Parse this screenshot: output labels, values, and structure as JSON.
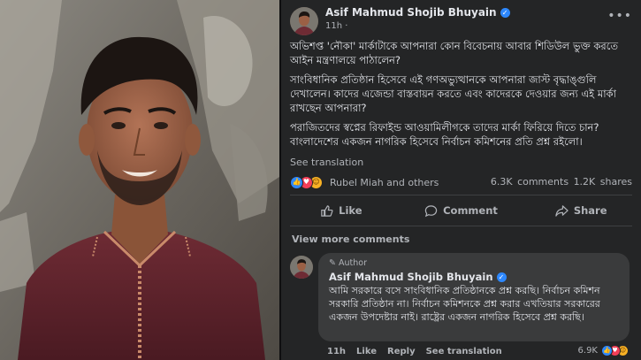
{
  "post": {
    "author": "Asif Mahmud Shojib Bhuyain",
    "time": "11h",
    "paragraphs": [
      "অভিশপ্ত 'নৌকা' মার্কাটাকে আপনারা কোন বিবেচনায় আবার শিডিউল ভুক্ত করতে আইন মন্ত্রণালয়ে পাঠালেন?",
      "সাংবিধানিক প্রতিষ্ঠান হিসেবে এই গণঅভ্যুত্থানকে আপনারা জাস্ট বৃদ্ধাঙ্গুলি দেখালেন। কাদের এজেন্ডা বাস্তবায়ন করতে এবং কাদেরকে দেওয়ার জন্য এই মার্কা রাখছেন আপনারা?",
      "পরাজিতদের স্বপ্নের রিফাইন্ড আওয়ামিলীগকে তাদের মার্কা ফিরিয়ে দিতে চান? বাংলাদেশের একজন নাগরিক হিসেবে নির্বাচন কমিশনের প্রতি প্রশ্ন রইলো।"
    ],
    "see_translation": "See translation",
    "reaction_names": "Rubel Miah and others",
    "comments_count": "6.3K comments",
    "shares_count": "1.2K shares",
    "actions": {
      "like": "Like",
      "comment": "Comment",
      "share": "Share"
    },
    "view_more_comments": "View more comments"
  },
  "comment": {
    "badge": "Author",
    "author": "Asif Mahmud Shojib Bhuyain",
    "text": "আমি সরকারে বসে সাংবিধানিক প্রতিষ্ঠানকে প্রশ্ন করছি। নির্বাচন কমিশন সরকারি প্রতিষ্ঠান না। নির্বাচন কমিশনকে প্রশ্ন করার এখতিয়ার সরকারের একজন উপদেষ্টার নাই। রাষ্ট্রের একজন নাগরিক হিসেবে প্রশ্ন করছি।",
    "time": "11h",
    "like": "Like",
    "reply": "Reply",
    "see_translation": "See translation",
    "reaction_count": "6.9K"
  },
  "icons": {
    "verified": "verified-badge-icon",
    "more": "more-options-icon",
    "like_reaction": "like-reaction-icon",
    "love_reaction": "love-reaction-icon",
    "haha_reaction": "haha-reaction-icon"
  },
  "colors": {
    "panel_bg": "#242526",
    "bubble_bg": "#3a3b3c",
    "verified_blue": "#2d88ff",
    "text_primary": "#e4e6eb",
    "text_secondary": "#b0b3b8"
  }
}
